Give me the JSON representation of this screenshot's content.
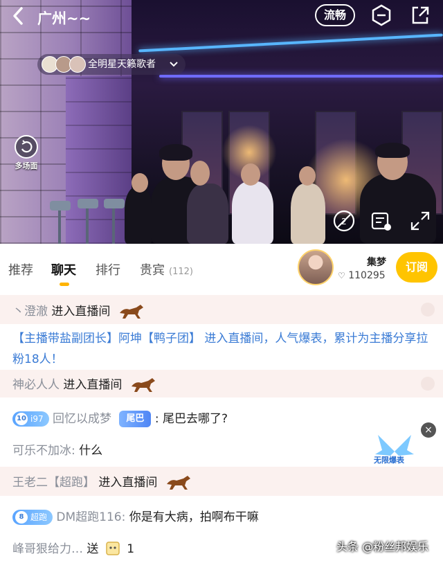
{
  "header": {
    "back_icon": "chevron-left-icon",
    "title": "广州~~",
    "quality_label": "流畅",
    "menu_icon": "hexagon-minus-icon",
    "share_icon": "share-icon"
  },
  "singers_pill": {
    "label": "全明星天籁歌者"
  },
  "video": {
    "multi_view_label": "多场面",
    "controls": [
      "mute-icon",
      "danmaku-settings-icon",
      "fullscreen-icon"
    ]
  },
  "tabs": [
    {
      "label": "推荐",
      "active": false
    },
    {
      "label": "聊天",
      "active": true
    },
    {
      "label": "排行",
      "active": false
    },
    {
      "label": "贵宾",
      "active": false,
      "count": "(112)"
    }
  ],
  "host": {
    "name": "集梦",
    "fans": "110295",
    "follow_label": "订阅"
  },
  "chat": [
    {
      "name": "丶澄澈",
      "text": "进入直播间"
    },
    {
      "system": "【主播带盐副团长】阿坤【鸭子团】 进入直播间，人气爆表，累计为主播分享拉粉18人！"
    },
    {
      "name": "神必人人",
      "text": "进入直播间"
    },
    {
      "level": "10",
      "badge": "i97",
      "name": "回忆以成梦",
      "tag": "尾巴",
      "text": "尾巴去哪了?"
    },
    {
      "name": "可乐不加冰:",
      "text": "什么"
    },
    {
      "name": "王老二【超跑】",
      "text": "进入直播间"
    },
    {
      "level": "8",
      "badge": "超跑",
      "name": "DM超跑116:",
      "text": "你是有大病，拍啊布干嘛"
    },
    {
      "name": "峰哥狠给力…",
      "action": "送",
      "count": "1"
    }
  ],
  "gift_float": {
    "label": "无限爆表"
  },
  "watermark": "头条 @粉丝邦娱乐",
  "colors": {
    "accent": "#ffc400",
    "link": "#3a7bd5",
    "chat_bg": "#fbf1ef"
  }
}
